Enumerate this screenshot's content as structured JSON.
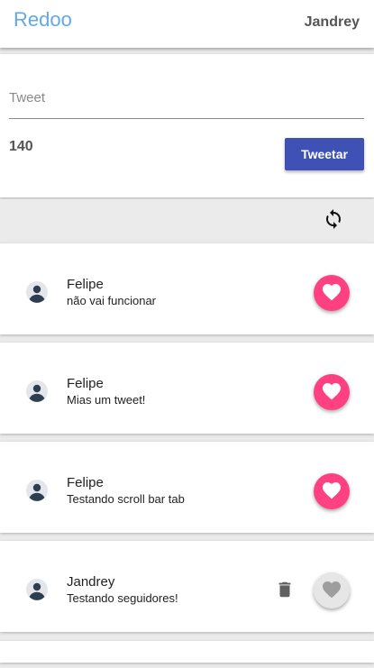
{
  "header": {
    "brand": "Redoo",
    "username": "Jandrey"
  },
  "composer": {
    "placeholder": "Tweet",
    "value": "",
    "char_count": "140",
    "submit_label": "Tweetar"
  },
  "feed": {
    "refresh_icon": "refresh-icon",
    "tweets": [
      {
        "author": "Felipe",
        "text": "não vai funcionar",
        "liked": true,
        "can_delete": false
      },
      {
        "author": "Felipe",
        "text": "Mias um tweet!",
        "liked": true,
        "can_delete": false
      },
      {
        "author": "Felipe",
        "text": "Testando scroll bar tab",
        "liked": true,
        "can_delete": false
      },
      {
        "author": "Jandrey",
        "text": "Testando seguidores!",
        "liked": false,
        "can_delete": true
      }
    ]
  },
  "colors": {
    "brand": "#64a8e6",
    "primary": "#3f51b5",
    "like_active": "#ff4081",
    "like_inactive": "#e6e6e6"
  }
}
